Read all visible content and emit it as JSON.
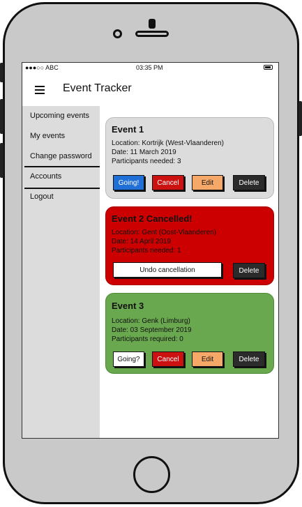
{
  "status_bar": {
    "carrier": "●●●○○ ABC",
    "time": "03:35 PM"
  },
  "app": {
    "title": "Event Tracker"
  },
  "drawer": {
    "items": [
      "Upcoming events",
      "My events",
      "Change password",
      "Accounts",
      "Logout"
    ]
  },
  "events": [
    {
      "title": "Event 1",
      "location": "Location: Kortrijk (West-Vlaanderen)",
      "date": "Date: 11 March 2019",
      "participants": "Participants needed: 3",
      "buttons": {
        "going": "Going!",
        "cancel": "Cancel",
        "edit": "Edit",
        "delete": "Delete"
      },
      "colors": {
        "card": "#dcdcdc",
        "going": "#1f6fd6",
        "cancel": "#cc1111",
        "edit": "#f5a867",
        "delete": "#2b2b2b"
      }
    },
    {
      "title": "Event 2 Cancelled!",
      "location": "Location: Gent (Oost-Vlaanderen)",
      "date": "Date: 14 April 2019",
      "participants": "Participants needed: 1",
      "buttons": {
        "undo": "Undo cancellation",
        "delete": "Delete"
      },
      "colors": {
        "card": "#cc0000",
        "undo": "#ffffff",
        "delete": "#2b2b2b"
      }
    },
    {
      "title": "Event 3",
      "location": "Location: Genk (Limburg)",
      "date": "Date: 03 September 2019",
      "participants": "Participants required: 0",
      "buttons": {
        "going": "Going?",
        "cancel": "Cancel",
        "edit": "Edit",
        "delete": "Delete"
      },
      "colors": {
        "card": "#6aa84f",
        "going": "#ffffff",
        "cancel": "#cc1111",
        "edit": "#f5a867",
        "delete": "#2b2b2b"
      }
    }
  ],
  "fab": {
    "icon": "plus-icon",
    "color": "#1f6fd6"
  }
}
